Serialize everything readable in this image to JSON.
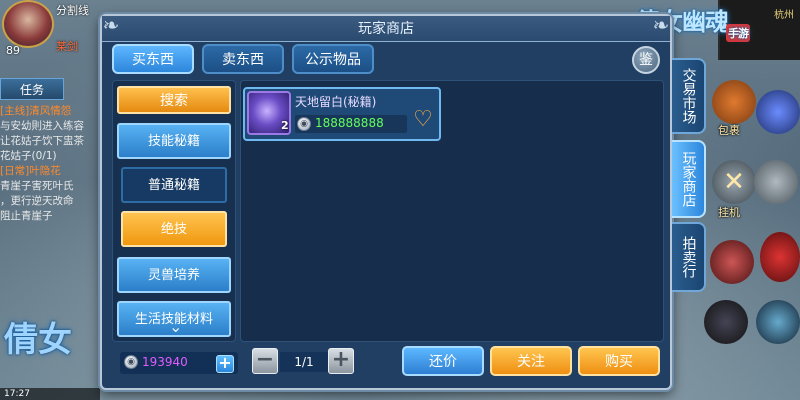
{
  "background_hud": {
    "player_level": "89",
    "player_name": "分割线",
    "player_sub": "某剑",
    "task_tab": "任务",
    "quests": [
      {
        "title": "[主线]清风情怨",
        "text": "与安幼則进入练容"
      },
      {
        "title": "",
        "text": "让花姑子饮下盅茶"
      },
      {
        "title": "",
        "text": "花姑子(0/1)"
      },
      {
        "title": "[日常]叶隐花",
        "text": "青崖子害死叶氏"
      },
      {
        "title": "",
        "text": "，更行逆天改命"
      },
      {
        "title": "",
        "text": "阻止青崖子"
      }
    ],
    "left_logo": "倩女",
    "status_time": "17:27",
    "right_logo": "倩女幽魂",
    "right_logo_badge": "手游",
    "minimap_label": "杭州",
    "icons": [
      {
        "name": "bag-icon",
        "label": "包裹"
      },
      {
        "name": "autofight-icon",
        "label": "挂机"
      }
    ]
  },
  "store": {
    "title": "玩家商店",
    "top_tabs": [
      "买东西",
      "卖东西",
      "公示物品"
    ],
    "appraise_label": "鉴",
    "categories": {
      "search": "搜索",
      "skill_books": "技能秘籍",
      "normal_books": "普通秘籍",
      "ultimate": "绝技",
      "pet_training": "灵兽培养",
      "life_materials": "生活技能材料"
    },
    "items": [
      {
        "name": "天地留白(秘籍)",
        "quantity": "2",
        "price": "188888888"
      }
    ],
    "bottom": {
      "money": "193940",
      "page": "1/1",
      "bargain": "还价",
      "follow": "关注",
      "buy": "购买"
    }
  },
  "side_tabs": [
    "交易市场",
    "玩家商店",
    "拍卖行"
  ]
}
